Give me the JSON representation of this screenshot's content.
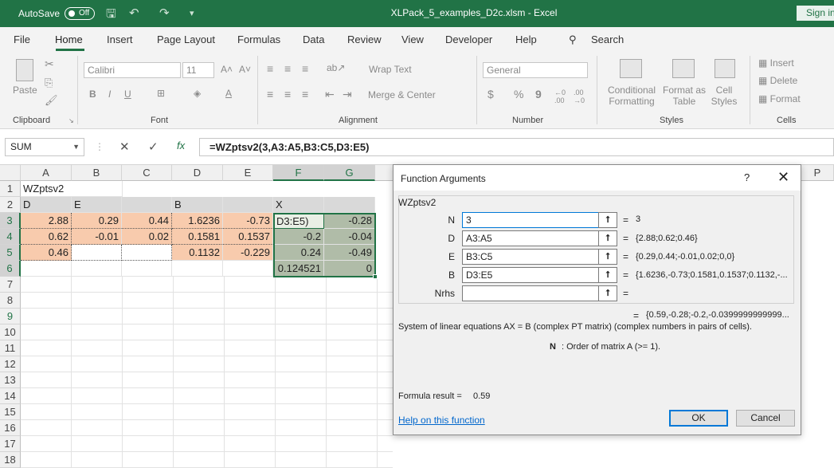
{
  "titlebar": {
    "autosave": "AutoSave",
    "toggle": "Off",
    "title": "XLPack_5_examples_D2c.xlsm - Excel",
    "signin": "Sign in"
  },
  "tabs": [
    "File",
    "Home",
    "Insert",
    "Page Layout",
    "Formulas",
    "Data",
    "Review",
    "View",
    "Developer",
    "Help"
  ],
  "search": "Search",
  "ribbon": {
    "clipboard": {
      "label": "Clipboard",
      "paste": "Paste"
    },
    "font": {
      "label": "Font",
      "name": "Calibri",
      "size": "11",
      "bold": "B",
      "italic": "I",
      "underline": "U"
    },
    "alignment": {
      "label": "Alignment",
      "wrap": "Wrap Text",
      "merge": "Merge & Center"
    },
    "number": {
      "label": "Number",
      "format": "General",
      "currency": "$",
      "percent": "%",
      "comma": "9"
    },
    "styles": {
      "label": "Styles",
      "conditional": "Conditional",
      "conditional2": "Formatting",
      "format_as": "Format as",
      "format_as2": "Table",
      "cell": "Cell",
      "cell2": "Styles"
    },
    "cells": {
      "label": "Cells",
      "insert": "Insert",
      "delete": "Delete",
      "format": "Format"
    }
  },
  "formula": {
    "namebox": "SUM",
    "fx": "fx",
    "content": "=WZptsv2(3,A3:A5,B3:C5,D3:E5)"
  },
  "columns": [
    "A",
    "B",
    "C",
    "D",
    "E",
    "F",
    "G",
    "",
    "",
    "",
    "",
    "",
    "",
    "",
    "",
    "P"
  ],
  "rows": [
    "1",
    "2",
    "3",
    "4",
    "5",
    "6",
    "7",
    "8",
    "9",
    "10",
    "11",
    "12",
    "13",
    "14",
    "15",
    "16",
    "17",
    "18"
  ],
  "cells": {
    "A1": "WZptsv2",
    "A2": "D",
    "B2": "E",
    "D2": "B",
    "F2": "X",
    "A3": "2.88",
    "B3": "0.29",
    "C3": "0.44",
    "D3": "1.6236",
    "E3": "-0.73",
    "F3": "D3:E5)",
    "G3": "-0.28",
    "A4": "0.62",
    "B4": "-0.01",
    "C4": "0.02",
    "D4": "0.1581",
    "E4": "0.1537",
    "F4": "-0.2",
    "G4": "-0.04",
    "A5": "0.46",
    "D5": "0.1132",
    "E5": "-0.229",
    "F5": "0.24",
    "G5": "-0.49",
    "F6": "0.124521",
    "G6": "0"
  },
  "dialog": {
    "title": "Function Arguments",
    "help_q": "?",
    "close": "✕",
    "group": "WZptsv2",
    "args": [
      {
        "label": "N",
        "value": "3",
        "result": "3"
      },
      {
        "label": "D",
        "value": "A3:A5",
        "result": "{2.88;0.62;0.46}"
      },
      {
        "label": "E",
        "value": "B3:C5",
        "result": "{0.29,0.44;-0.01,0.02;0,0}"
      },
      {
        "label": "B",
        "value": "D3:E5",
        "result": "{1.6236,-0.73;0.1581,0.1537;0.1132,-..."
      },
      {
        "label": "Nrhs",
        "value": "",
        "result": ""
      }
    ],
    "eq": "=",
    "overall": "{0.59,-0.28;-0.2,-0.0399999999999...",
    "description": "System of linear equations AX = B (complex PT matrix) (complex numbers in pairs of cells).",
    "arg_name": "N",
    "arg_desc": ":  Order of matrix A (>= 1).",
    "result_label": "Formula result =",
    "result_value": "0.59",
    "help": "Help on this function",
    "ok": "OK",
    "cancel": "Cancel"
  }
}
